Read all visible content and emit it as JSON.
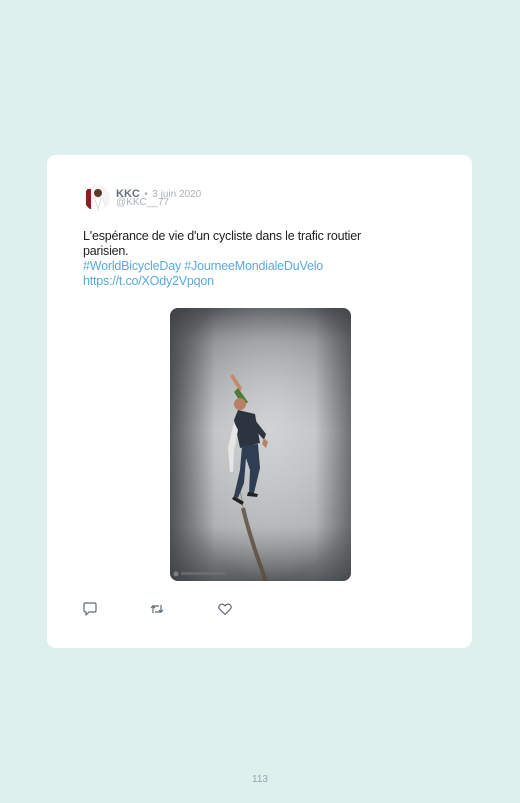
{
  "tweet": {
    "author_name": "KKC",
    "separator": "•",
    "date": "3 juin 2020",
    "handle": "@KKC__77",
    "text_line": "L'espérance de vie d'un cycliste dans le trafic routier parisien.",
    "hashtags": "#WorldBicycleDay #JourneeMondialeDuVelo",
    "url": "https://t.co/XOdy2Vpqon"
  },
  "actions": {
    "reply_icon": "reply-icon",
    "retweet_icon": "retweet-icon",
    "like_icon": "heart-icon"
  },
  "colors": {
    "background": "#ddf0ee",
    "card": "#ffffff",
    "link": "#5aa9dd"
  },
  "footer": {
    "page_number": "113"
  }
}
